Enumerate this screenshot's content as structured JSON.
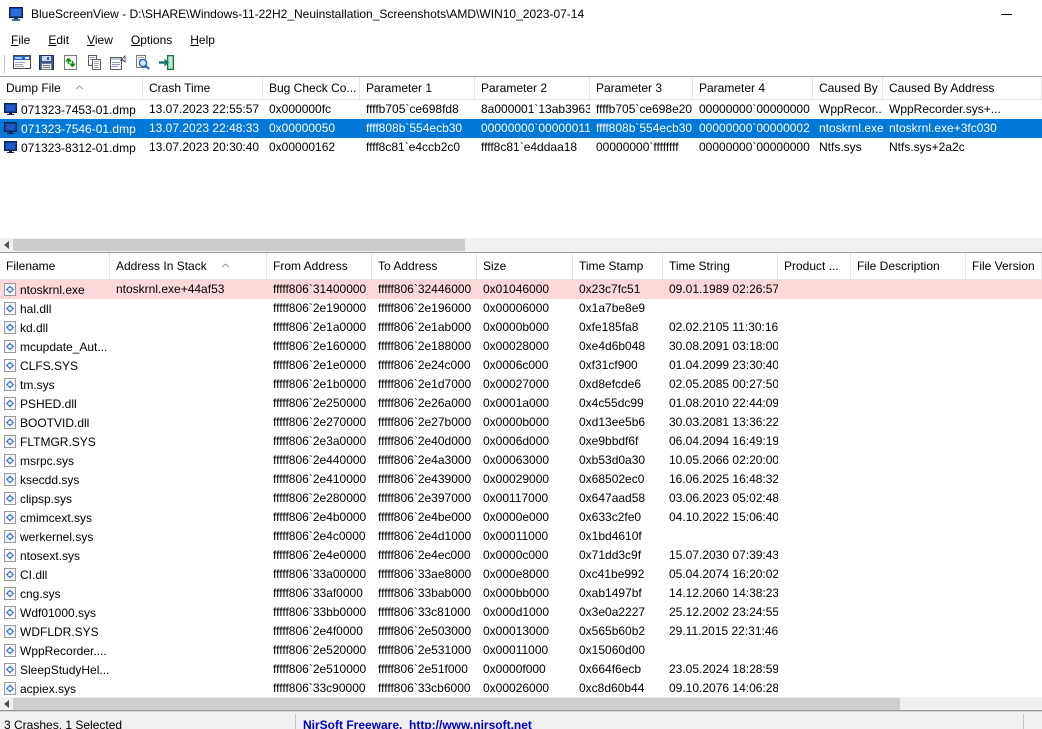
{
  "window": {
    "title": "BlueScreenView  -  D:\\SHARE\\Windows-11-22H2_Neuinstallation_Screenshots\\AMD\\WIN10_2023-07-14",
    "controls": [
      "minimize"
    ]
  },
  "menu": {
    "items": [
      "File",
      "Edit",
      "View",
      "Options",
      "Help"
    ]
  },
  "toolbar": {
    "buttons": [
      {
        "name": "dump-properties",
        "icon": "properties-window-icon"
      },
      {
        "name": "save",
        "icon": "save-icon"
      },
      {
        "name": "refresh",
        "icon": "refresh-icon"
      },
      {
        "name": "copy",
        "icon": "copy-icon"
      },
      {
        "name": "item-properties",
        "icon": "item-properties-icon"
      },
      {
        "name": "find",
        "icon": "find-icon"
      },
      {
        "name": "exit",
        "icon": "exit-door-icon"
      }
    ]
  },
  "upper_table": {
    "columns": [
      "Dump File",
      "Crash Time",
      "Bug Check Co...",
      "Parameter 1",
      "Parameter 2",
      "Parameter 3",
      "Parameter 4",
      "Caused By ...",
      "Caused By Address"
    ],
    "sort": {
      "column": "Dump File",
      "direction": "ascending"
    },
    "selected_row": 1,
    "rows": [
      [
        "071323-7453-01.dmp",
        "13.07.2023 22:55:57",
        "0x000000fc",
        "ffffb705`ce698fd8",
        "8a000001`13ab3963",
        "ffffb705`ce698e20",
        "00000000`00000000",
        "WppRecor...",
        "WppRecorder.sys+..."
      ],
      [
        "071323-7546-01.dmp",
        "13.07.2023 22:48:33",
        "0x00000050",
        "ffff808b`554ecb30",
        "00000000`00000011",
        "ffff808b`554ecb30",
        "00000000`00000002",
        "ntoskrnl.exe",
        "ntoskrnl.exe+3fc030"
      ],
      [
        "071323-8312-01.dmp",
        "13.07.2023 20:30:40",
        "0x00000162",
        "ffff8c81`e4ccb2c0",
        "ffff8c81`e4ddaa18",
        "00000000`ffffffff",
        "00000000`00000000",
        "Ntfs.sys",
        "Ntfs.sys+2a2c"
      ]
    ]
  },
  "lower_table": {
    "columns": [
      "Filename",
      "Address In Stack",
      "From Address",
      "To Address",
      "Size",
      "Time Stamp",
      "Time String",
      "Product ...",
      "File Description",
      "File Version"
    ],
    "sort": {
      "column": "Address In Stack",
      "direction": "ascending"
    },
    "highlighted_row": 0,
    "rows": [
      [
        "ntoskrnl.exe",
        "ntoskrnl.exe+44af53",
        "fffff806`31400000",
        "fffff806`32446000",
        "0x01046000",
        "0x23c7fc51",
        "09.01.1989 02:26:57",
        "",
        "",
        ""
      ],
      [
        "hal.dll",
        "",
        "fffff806`2e190000",
        "fffff806`2e196000",
        "0x00006000",
        "0x1a7be8e9",
        "",
        "",
        "",
        ""
      ],
      [
        "kd.dll",
        "",
        "fffff806`2e1a0000",
        "fffff806`2e1ab000",
        "0x0000b000",
        "0xfe185fa8",
        "02.02.2105 11:30:16",
        "",
        "",
        ""
      ],
      [
        "mcupdate_Aut...",
        "",
        "fffff806`2e160000",
        "fffff806`2e188000",
        "0x00028000",
        "0xe4d6b048",
        "30.08.2091 03:18:00",
        "",
        "",
        ""
      ],
      [
        "CLFS.SYS",
        "",
        "fffff806`2e1e0000",
        "fffff806`2e24c000",
        "0x0006c000",
        "0xf31cf900",
        "01.04.2099 23:30:40",
        "",
        "",
        ""
      ],
      [
        "tm.sys",
        "",
        "fffff806`2e1b0000",
        "fffff806`2e1d7000",
        "0x00027000",
        "0xd8efcde6",
        "02.05.2085 00:27:50",
        "",
        "",
        ""
      ],
      [
        "PSHED.dll",
        "",
        "fffff806`2e250000",
        "fffff806`2e26a000",
        "0x0001a000",
        "0x4c55dc99",
        "01.08.2010 22:44:09",
        "",
        "",
        ""
      ],
      [
        "BOOTVID.dll",
        "",
        "fffff806`2e270000",
        "fffff806`2e27b000",
        "0x0000b000",
        "0xd13ee5b6",
        "30.03.2081 13:36:22",
        "",
        "",
        ""
      ],
      [
        "FLTMGR.SYS",
        "",
        "fffff806`2e3a0000",
        "fffff806`2e40d000",
        "0x0006d000",
        "0xe9bbdf6f",
        "06.04.2094 16:49:19",
        "",
        "",
        ""
      ],
      [
        "msrpc.sys",
        "",
        "fffff806`2e440000",
        "fffff806`2e4a3000",
        "0x00063000",
        "0xb53d0a30",
        "10.05.2066 02:20:00",
        "",
        "",
        ""
      ],
      [
        "ksecdd.sys",
        "",
        "fffff806`2e410000",
        "fffff806`2e439000",
        "0x00029000",
        "0x68502ec0",
        "16.06.2025 16:48:32",
        "",
        "",
        ""
      ],
      [
        "clipsp.sys",
        "",
        "fffff806`2e280000",
        "fffff806`2e397000",
        "0x00117000",
        "0x647aad58",
        "03.06.2023 05:02:48",
        "",
        "",
        ""
      ],
      [
        "cmimcext.sys",
        "",
        "fffff806`2e4b0000",
        "fffff806`2e4be000",
        "0x0000e000",
        "0x633c2fe0",
        "04.10.2022 15:06:40",
        "",
        "",
        ""
      ],
      [
        "werkernel.sys",
        "",
        "fffff806`2e4c0000",
        "fffff806`2e4d1000",
        "0x00011000",
        "0x1bd4610f",
        "",
        "",
        "",
        ""
      ],
      [
        "ntosext.sys",
        "",
        "fffff806`2e4e0000",
        "fffff806`2e4ec000",
        "0x0000c000",
        "0x71dd3c9f",
        "15.07.2030 07:39:43",
        "",
        "",
        ""
      ],
      [
        "CI.dll",
        "",
        "fffff806`33a00000",
        "fffff806`33ae8000",
        "0x000e8000",
        "0xc41be992",
        "05.04.2074 16:20:02",
        "",
        "",
        ""
      ],
      [
        "cng.sys",
        "",
        "fffff806`33af0000",
        "fffff806`33bab000",
        "0x000bb000",
        "0xab1497bf",
        "14.12.2060 14:38:23",
        "",
        "",
        ""
      ],
      [
        "Wdf01000.sys",
        "",
        "fffff806`33bb0000",
        "fffff806`33c81000",
        "0x000d1000",
        "0x3e0a2227",
        "25.12.2002 23:24:55",
        "",
        "",
        ""
      ],
      [
        "WDFLDR.SYS",
        "",
        "fffff806`2e4f0000",
        "fffff806`2e503000",
        "0x00013000",
        "0x565b60b2",
        "29.11.2015 22:31:46",
        "",
        "",
        ""
      ],
      [
        "WppRecorder....",
        "",
        "fffff806`2e520000",
        "fffff806`2e531000",
        "0x00011000",
        "0x15060d00",
        "",
        "",
        "",
        ""
      ],
      [
        "SleepStudyHel...",
        "",
        "fffff806`2e510000",
        "fffff806`2e51f000",
        "0x0000f000",
        "0x664f6ecb",
        "23.05.2024 18:28:59",
        "",
        "",
        ""
      ],
      [
        "acpiex.sys",
        "",
        "fffff806`33c90000",
        "fffff806`33cb6000",
        "0x00026000",
        "0xc8d60b44",
        "09.10.2076 14:06:28",
        "",
        "",
        ""
      ]
    ]
  },
  "status_bar": {
    "crashes_summary": "3 Crashes, 1 Selected",
    "nirsoft_link": "NirSoft Freeware.  http://www.nirsoft.net"
  },
  "colors": {
    "selection": "#0078d7",
    "crash_module_highlight": "#fdd8d8",
    "link_blue": "#0000cc"
  }
}
